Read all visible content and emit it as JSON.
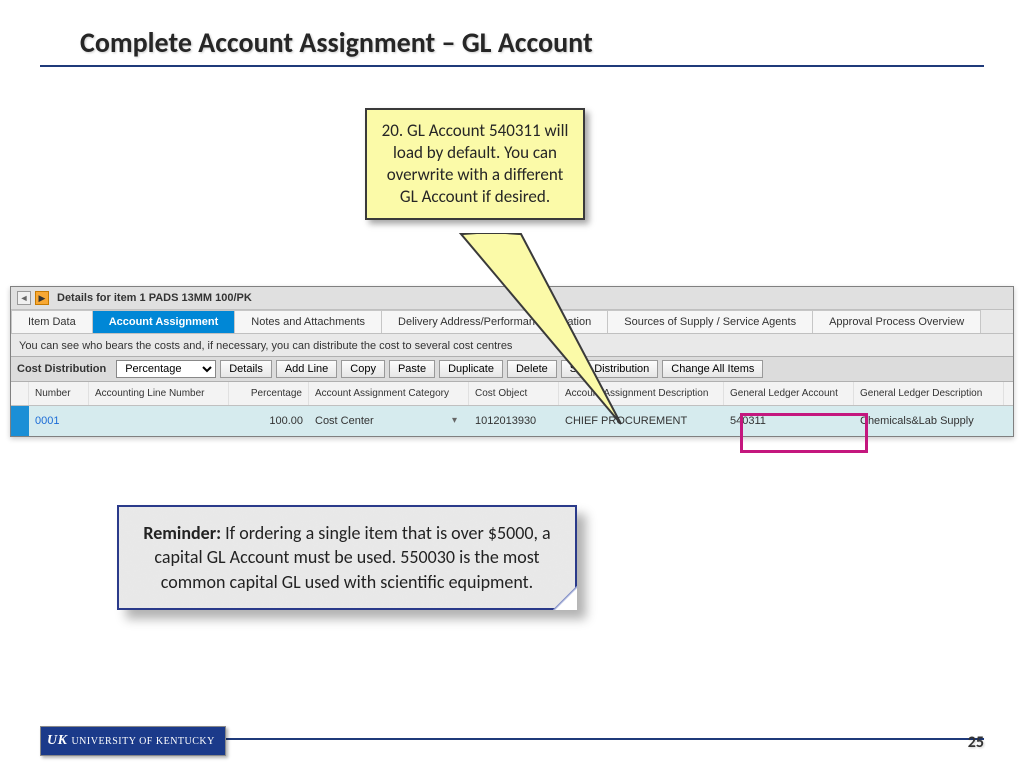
{
  "title": "Complete Account Assignment – GL Account",
  "callout": "20. GL Account 540311 will load by default. You can overwrite with a different GL Account if desired.",
  "panel": {
    "header": "Details for item 1  PADS 13MM 100/PK",
    "tabs": [
      "Item Data",
      "Account Assignment",
      "Notes and Attachments",
      "Delivery Address/Performance Location",
      "Sources of Supply / Service Agents",
      "Approval Process Overview"
    ],
    "info": "You can see who bears the costs and, if necessary, you can distribute the cost to several cost centres",
    "dist_label": "Cost Distribution",
    "dist_select": "Percentage",
    "buttons": [
      "Details",
      "Add Line",
      "Copy",
      "Paste",
      "Duplicate",
      "Delete",
      "Split Distribution",
      "Change All Items"
    ],
    "columns": [
      "Number",
      "Accounting Line Number",
      "Percentage",
      "Account Assignment Category",
      "Cost Object",
      "Account Assignment Description",
      "General Ledger Account",
      "General Ledger Description"
    ],
    "row": {
      "number": "0001",
      "aln": "",
      "pct": "100.00",
      "cat": "Cost Center",
      "obj": "1012013930",
      "desc": "CHIEF PROCUREMENT",
      "gla": "540311",
      "gld": "Chemicals&Lab Supply"
    }
  },
  "reminder": {
    "label": "Reminder:",
    "text": " If ordering a single item that is over $5000, a capital GL Account must be used. 550030 is the most common capital GL used with scientific equipment."
  },
  "footer": {
    "logo_mark": "UK",
    "logo_text": "UNIVERSITY OF KENTUCKY"
  },
  "page_number": "25"
}
